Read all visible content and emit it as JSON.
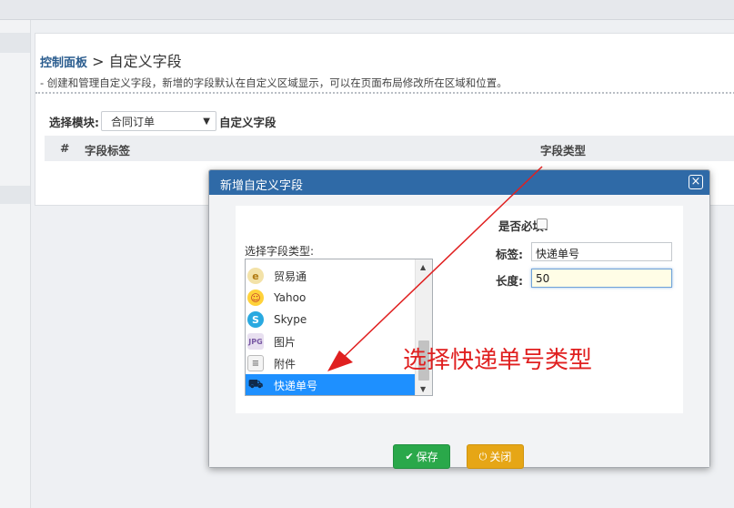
{
  "breadcrumb": {
    "root": "控制面板",
    "separator": ">",
    "current": "自定义字段"
  },
  "description": "- 创建和管理自定义字段，新增的字段默认在自定义区域显示，可以在页面布局修改所在区域和位置。",
  "module_select": {
    "label": "选择模块:",
    "value": "合同订单",
    "suffix": "自定义字段"
  },
  "table_headers": [
    "#",
    "字段标签",
    "字段类型"
  ],
  "dialog": {
    "title": "新增自定义字段",
    "field_type_label": "选择字段类型:",
    "field_types": [
      {
        "label": "贸易通",
        "icon": "trademanager-icon"
      },
      {
        "label": "Yahoo",
        "icon": "yahoo-icon"
      },
      {
        "label": "Skype",
        "icon": "skype-icon"
      },
      {
        "label": "图片",
        "icon": "image-icon"
      },
      {
        "label": "附件",
        "icon": "attachment-icon"
      },
      {
        "label": "快递单号",
        "icon": "truck-icon",
        "selected": true
      }
    ],
    "required_label": "是否必填:",
    "tag_label": "标签:",
    "tag_value": "快递单号",
    "length_label": "长度:",
    "length_value": "50",
    "save_label": "保存",
    "close_label": "关闭"
  },
  "annotation": "选择快递单号类型",
  "colors": {
    "header_blue": "#2f6aa7",
    "selection": "#1e90ff",
    "save_green": "#2aa84a",
    "close_orange": "#e6a616",
    "annotation_red": "#e02020"
  }
}
